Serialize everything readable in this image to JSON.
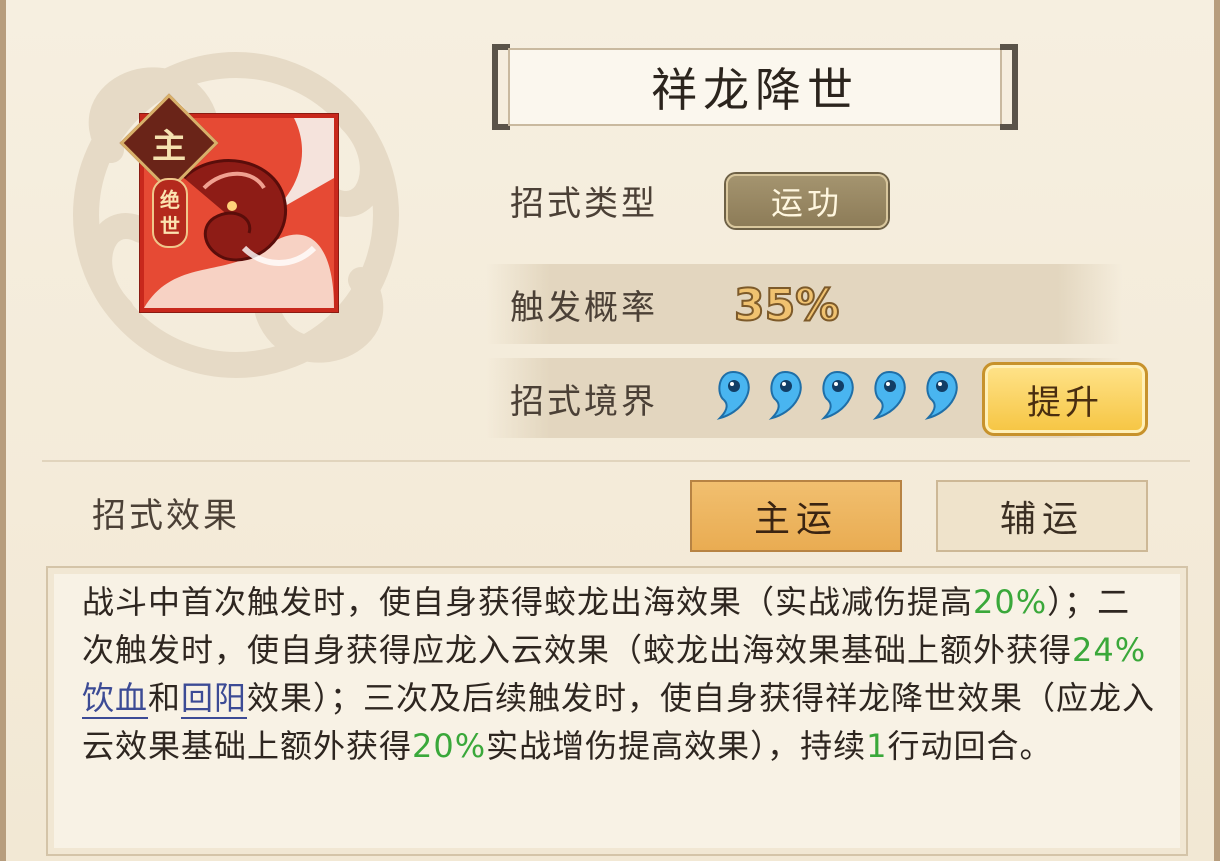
{
  "skill": {
    "name": "祥龙降世",
    "badge_main": "主",
    "tag_vertical": [
      "绝",
      "世"
    ]
  },
  "info": {
    "type_label": "招式类型",
    "type_value": "运功",
    "rate_label": "触发概率",
    "rate_value": "35%",
    "realm_label": "招式境界",
    "realm_level": 5,
    "realm_max": 5,
    "upgrade_label": "提升"
  },
  "effects": {
    "label": "招式效果",
    "tab_primary": "主运",
    "tab_secondary": "辅运",
    "description": {
      "p1": "战斗中首次触发时，使自身获得蛟龙出海效果（实战减伤提高",
      "v1": "20%",
      "p2": "）；二次触发时，使自身获得应龙入云效果（蛟龙出海效果基础上额外获得",
      "v2": "24%",
      "link1": "饮血",
      "p3": "和",
      "link2": "回阳",
      "p4": "效果）；三次及后续触发时，使自身获得祥龙降世效果（应龙入云效果基础上额外获得",
      "v3": "20%",
      "p5": "实战增伤提高效果），持续",
      "v4": "1",
      "p6": "行动回合。"
    }
  },
  "colors": {
    "highlight_green": "#3aa83a",
    "link_blue": "#3c4b95",
    "tab_active": "#e9ac52",
    "upgrade_gold": "#f6c542",
    "pip_blue": "#49b5f0"
  },
  "icons": {
    "realm_pip": "water-drop-icon",
    "cloud_emblem": "cloud-swirl-icon",
    "skill_icon": "dragon-icon"
  }
}
